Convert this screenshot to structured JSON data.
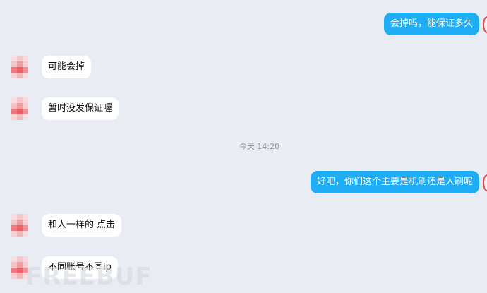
{
  "messages": {
    "m1": "会掉吗，能保证多久",
    "m2": "可能会掉",
    "m3": "暂时没发保证喔",
    "m4": "好吧，你们这个主要是机刷还是人刷呢",
    "m5": "和人一样的 点击",
    "m6": "不同账号不同ip"
  },
  "timestamp": "今天 14:20",
  "watermark": "FREEBUF",
  "colors": {
    "background": "#e9edf3",
    "outgoing_bubble": "#1faef5",
    "incoming_bubble": "#ffffff",
    "avatar_red": "#ee7a80",
    "self_avatar_ring": "#e8464f"
  }
}
